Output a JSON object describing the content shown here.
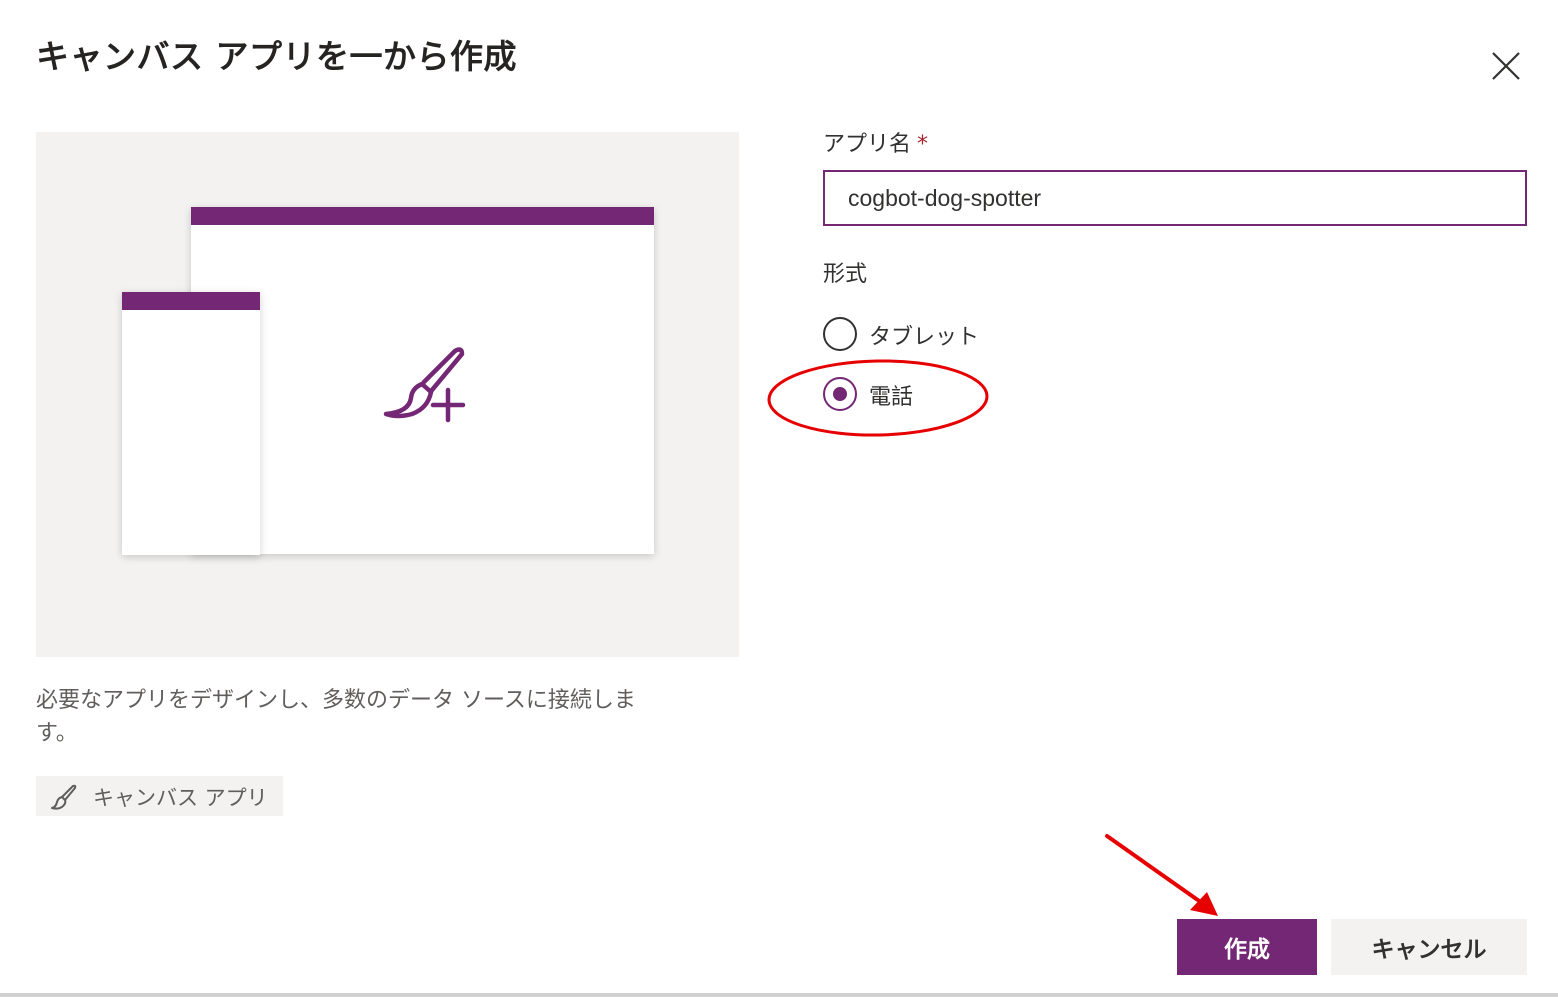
{
  "dialog": {
    "title": "キャンバス アプリを一から作成",
    "close_icon": "close-icon"
  },
  "preview": {
    "illustration_icon": "paintbrush-add-icon",
    "accent_color": "#742774",
    "background_color": "#f3f2f1"
  },
  "description": "必要なアプリをデザインし、多数のデータ ソースに接続します。",
  "tag": {
    "icon": "paintbrush-icon",
    "label": "キャンバス アプリ"
  },
  "form": {
    "app_name_label": "アプリ名",
    "required_marker": "*",
    "app_name_value": "cogbot-dog-spotter",
    "format_label": "形式",
    "format_options": [
      {
        "label": "タブレット",
        "selected": false
      },
      {
        "label": "電話",
        "selected": true
      }
    ]
  },
  "buttons": {
    "create_label": "作成",
    "cancel_label": "キャンセル"
  },
  "annotations": {
    "highlight_color": "#e60000"
  }
}
